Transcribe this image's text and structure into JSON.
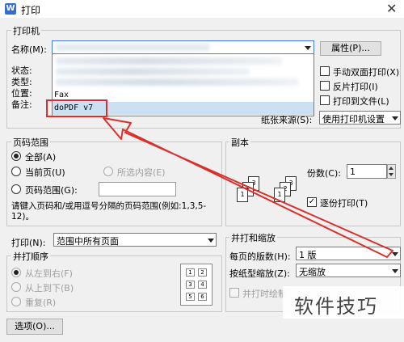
{
  "window": {
    "title": "打印",
    "app_icon": "W",
    "close_glyph": "✕"
  },
  "printer": {
    "group_label": "打印机",
    "name_label": "名称(M):",
    "properties_button": "属性(P)...",
    "status_label": "状态:",
    "type_label": "类型:",
    "location_label": "位置:",
    "comment_label": "备注:",
    "options": [
      "Fax",
      "doPDF v7"
    ],
    "selected_option": "doPDF v7",
    "manual_duplex": "手动双面打印(X)",
    "reverse_print": "反片打印(I)",
    "print_to_file": "打印到文件(L)",
    "paper_source_label": "纸张来源(S):",
    "paper_source_value": "使用打印机设置"
  },
  "page_range": {
    "group_label": "页码范围",
    "all": "全部(A)",
    "current_page": "当前页(U)",
    "selection": "所选内容(E)",
    "pages": "页码范围(G):",
    "pages_value": "",
    "hint": "请键入页码和/或用逗号分隔的页码范围(例如:1,3,5-12)。"
  },
  "copies": {
    "group_label": "副本",
    "count_label": "份数(C):",
    "count_value": "1",
    "collate_label": "逐份打印(T)",
    "stack_a": [
      "3",
      "2",
      "1"
    ],
    "stack_b": [
      "3",
      "2",
      "1"
    ]
  },
  "print_what": {
    "label": "打印(N):",
    "value": "范围中所有页面"
  },
  "order": {
    "group_label": "并打顺序",
    "left_to_right": "从左到右(F)",
    "top_to_bottom": "从上到下(B)",
    "repeat": "重复(R)",
    "preview_cells": [
      "1",
      "2",
      "3",
      "4",
      "5",
      "6"
    ]
  },
  "zoom": {
    "group_label": "并打和缩放",
    "pages_per_sheet_label": "每页的版数(H):",
    "pages_per_sheet_value": "1 版",
    "scale_label": "按纸型缩放(Z):",
    "scale_value": "无缩放",
    "combine_label": "并打时绘制"
  },
  "footer": {
    "options_button": "选项(O)..."
  },
  "watermark": "软件技巧",
  "colors": {
    "highlight": "#cce0f4",
    "annotation": "#d9302c"
  }
}
